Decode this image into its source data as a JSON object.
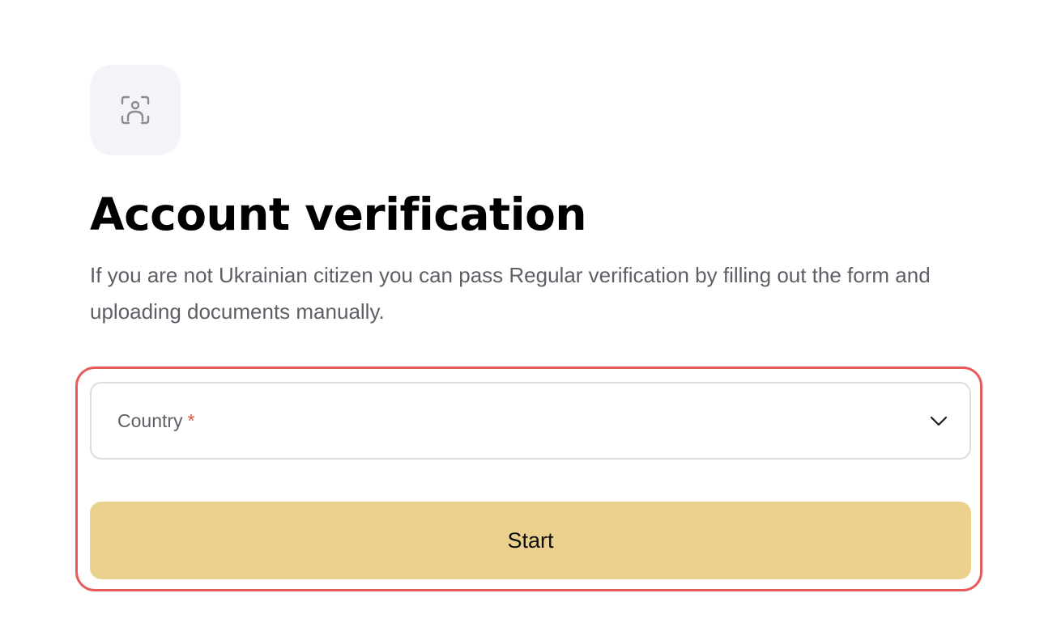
{
  "header": {
    "icon": "face-scan-icon",
    "title": "Account verification",
    "description": "If you are not Ukrainian citizen you can pass Regular verification by filling out the form and uploading documents manually."
  },
  "form": {
    "country": {
      "label": "Country",
      "required_mark": "*",
      "value": "",
      "icon": "chevron-down-icon"
    },
    "start_label": "Start"
  },
  "colors": {
    "highlight_border": "#e85a5a",
    "start_button_bg": "#ecd18e",
    "required_mark": "#e0533f",
    "icon_tile_bg": "#f3f4f7",
    "icon_stroke": "#8a8b95"
  }
}
